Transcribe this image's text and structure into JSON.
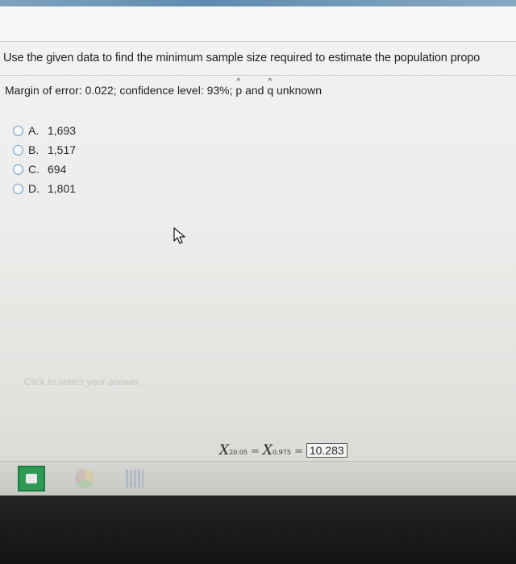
{
  "question": {
    "prompt": "Use the given data to find the minimum sample size required to estimate the population propo",
    "given_prefix": "Margin of error: 0.022; confidence level: 93%;",
    "p_letter": "p",
    "and_text": "and",
    "q_letter": "q",
    "unknown_text": "unknown"
  },
  "choices": [
    {
      "letter": "A.",
      "value": "1,693"
    },
    {
      "letter": "B.",
      "value": "1,517"
    },
    {
      "letter": "C.",
      "value": "694"
    },
    {
      "letter": "D.",
      "value": "1,801"
    }
  ],
  "hint": "Click to select your answer.",
  "formula": {
    "lhs_symbol": "X",
    "lhs_sup": "2",
    "lhs_sub": "0.05",
    "eq1": "=",
    "rhs_symbol": "X",
    "rhs_sub": "0.975",
    "eq2": "=",
    "result": "10.283"
  },
  "taskbar": {
    "icons": [
      "store-icon",
      "chrome-icon",
      "calculator-icon"
    ]
  },
  "colors": {
    "radio_border": "#6a9ec7",
    "store_green": "#2f9a55",
    "top_accent": "#5d8bb0"
  }
}
